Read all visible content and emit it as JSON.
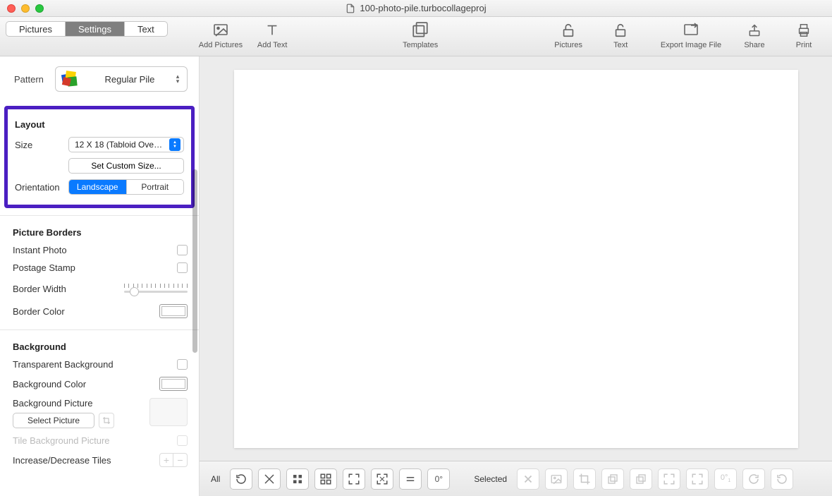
{
  "window": {
    "title": "100-photo-pile.turbocollageproj"
  },
  "tabs": {
    "pictures": "Pictures",
    "settings": "Settings",
    "text": "Text",
    "active": "settings"
  },
  "toolbar": {
    "add_pictures": "Add Pictures",
    "add_text": "Add Text",
    "templates": "Templates",
    "lock_pictures": "Pictures",
    "lock_text": "Text",
    "export": "Export Image File",
    "share": "Share",
    "print": "Print"
  },
  "pattern": {
    "label": "Pattern",
    "value": "Regular Pile"
  },
  "layout": {
    "title": "Layout",
    "size_label": "Size",
    "size_value": "12 X 18 (Tabloid Ove…",
    "custom_size": "Set Custom Size...",
    "orientation_label": "Orientation",
    "landscape": "Landscape",
    "portrait": "Portrait"
  },
  "picture_borders": {
    "title": "Picture Borders",
    "instant_photo": "Instant Photo",
    "postage_stamp": "Postage Stamp",
    "border_width": "Border Width",
    "border_color": "Border Color"
  },
  "background": {
    "title": "Background",
    "transparent": "Transparent Background",
    "color": "Background Color",
    "picture": "Background Picture",
    "select_picture": "Select Picture",
    "tile": "Tile Background Picture",
    "tiles": "Increase/Decrease Tiles"
  },
  "bottombar": {
    "all": "All",
    "selected": "Selected",
    "zero_deg": "0°"
  }
}
